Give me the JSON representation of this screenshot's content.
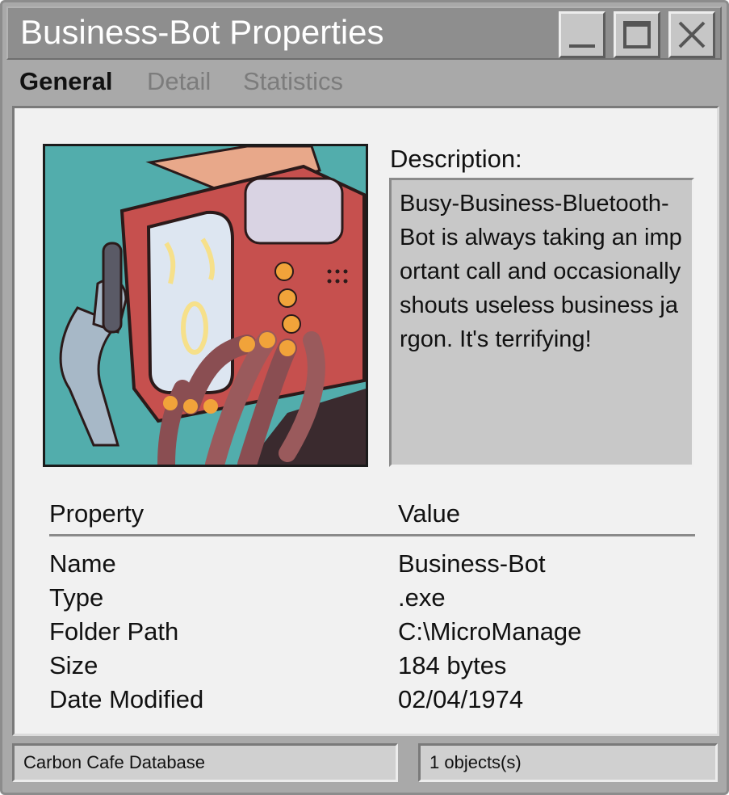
{
  "window": {
    "title": "Business-Bot Properties",
    "controls": [
      {
        "name": "minimize",
        "icon": "minimize-icon"
      },
      {
        "name": "maximize",
        "icon": "maximize-icon"
      },
      {
        "name": "close",
        "icon": "close-icon"
      }
    ]
  },
  "tabs": [
    {
      "label": "General",
      "active": true
    },
    {
      "label": "Detail",
      "active": false
    },
    {
      "label": "Statistics",
      "active": false
    }
  ],
  "general": {
    "image_icon": "robot-portrait-image",
    "description_label": "Description:",
    "description": "Busy-Business-Bluetooth-Bot is always taking an important call and occasionally shouts useless business jargon. It's terrifying!",
    "table": {
      "headers": {
        "property": "Property",
        "value": "Value"
      },
      "rows": [
        {
          "property": "Name",
          "value": "Business-Bot"
        },
        {
          "property": "Type",
          "value": ".exe"
        },
        {
          "property": "Folder Path",
          "value": "C:\\MicroManage"
        },
        {
          "property": "Size",
          "value": "184 bytes"
        },
        {
          "property": "Date Modified",
          "value": "02/04/1974"
        }
      ]
    }
  },
  "statusbar": {
    "left": "Carbon Cafe Database",
    "right": "1 objects(s)"
  },
  "colors": {
    "titlebar": "#8e8e8e",
    "window_frame": "#a9a9a9",
    "panel": "#f1f1f1",
    "description_box": "#c8c8c8",
    "portrait_background": "#52adac"
  }
}
